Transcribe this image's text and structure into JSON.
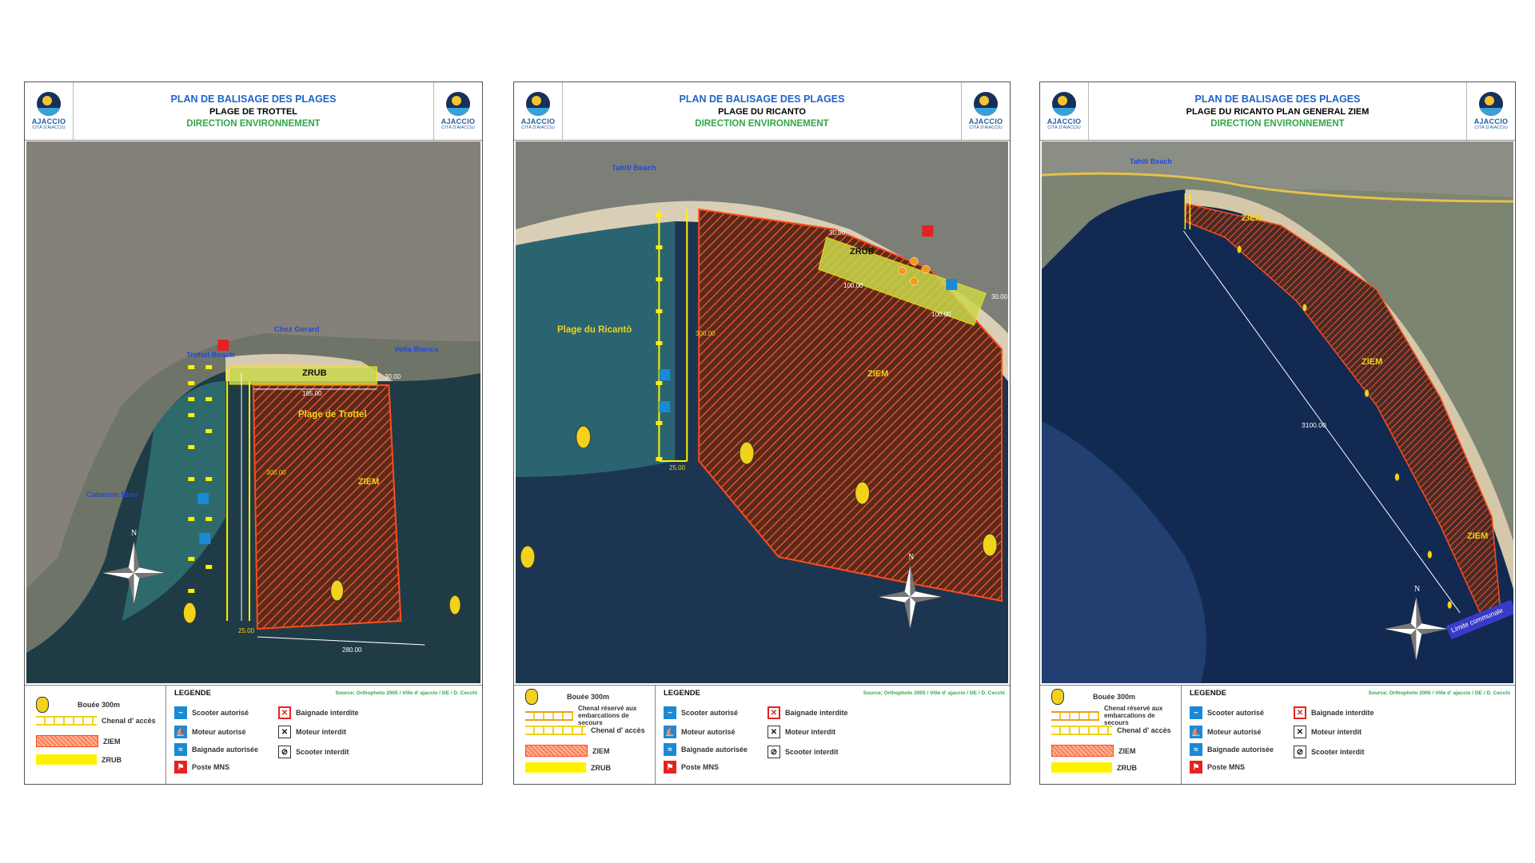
{
  "common": {
    "plan_title": "PLAN DE BALISAGE DES PLAGES",
    "direction": "DIRECTION ENVIRONNEMENT",
    "logo_name": "AJACCIO",
    "logo_sub": "CITÀ D'AIACCIU",
    "legend_title": "LEGENDE",
    "north": "N",
    "legend": {
      "bouee": "Bouée 300m",
      "chenal_secours": "Chenal réservé aux embarcations de secours",
      "chenal_acces": "Chenal d' accès",
      "ziem": "ZIEM",
      "zrub": "ZRUB",
      "scooter_autorise": "Scooter autorisé",
      "moteur_autorise": "Moteur autorisé",
      "baignade_autorisee": "Baignade autorisée",
      "poste_mns": "Poste MNS",
      "baignade_interdite": "Baignade interdite",
      "moteur_interdit": "Moteur interdit",
      "scooter_interdit": "Scooter interdit"
    },
    "colors": {
      "title_blue": "#1e64c8",
      "title_green": "#2fa84a",
      "ziem": "#ff4b1c",
      "zrub": "#fff200",
      "buoy": "#f2d21a"
    }
  },
  "sheets": [
    {
      "subtitle": "PLAGE DE TROTTEL",
      "source": "Source; Orthophoto 2005 / Ville d' ajaccio / DE / D. Cecchi",
      "labels": {
        "chez_gerard": "Chez Gerard",
        "trottel_beach": "Trottel Beach",
        "vella_bianca": "Vella Bianca",
        "zrub": "ZRUB",
        "plage": "Plage de Trottel",
        "ziem": "ZIEM",
        "cabanon": "Cabanon Bleu",
        "d185": "185.00",
        "d30": "30.00",
        "d300": "300.00",
        "d25": "25.00",
        "d280": "280.00"
      }
    },
    {
      "subtitle": "PLAGE DU RICANTO",
      "source": "Source; Orthophoto 2005 / Ville d' ajaccio / DE / D. Cecchi",
      "labels": {
        "tahiti": "Tahiti Beach",
        "zrub": "ZRUB",
        "d30a": "30.00",
        "d100a": "100.00",
        "d100b": "100.00",
        "d30b": "30.00",
        "plage": "Plage du Ricantò",
        "d300": "300.00",
        "ziem": "ZIEM",
        "d25": "25.00"
      }
    },
    {
      "subtitle": "PLAGE DU RICANTO PLAN GENERAL ZIEM",
      "source": "Source; Orthophoto 2005 / Ville d' ajaccio / DE / D. Cecchi",
      "labels": {
        "tahiti": "Tahiti Beach",
        "ziem1": "ZIEM",
        "ziem2": "ZIEM",
        "ziem3": "ZIEM",
        "d3100": "3100.00",
        "limite": "Limite communale"
      }
    }
  ]
}
